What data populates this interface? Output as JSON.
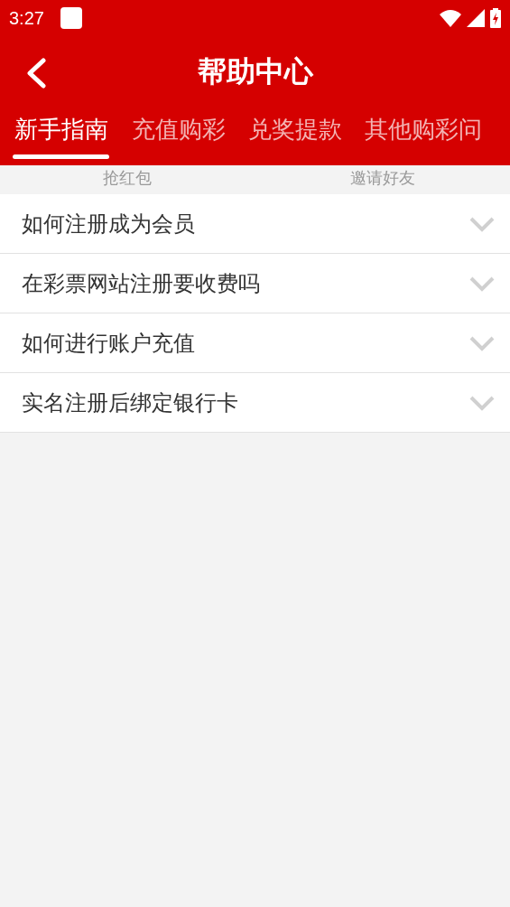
{
  "status_bar": {
    "time": "3:27"
  },
  "header": {
    "title": "帮助中心"
  },
  "tabs": [
    {
      "label": "新手指南",
      "selected": true
    },
    {
      "label": "充值购彩",
      "selected": false
    },
    {
      "label": "兑奖提款",
      "selected": false
    },
    {
      "label": "其他购彩问",
      "selected": false
    }
  ],
  "background_links": [
    "抢红包",
    "邀请好友"
  ],
  "questions": [
    {
      "title": "如何注册成为会员",
      "expanded": false
    },
    {
      "title": "在彩票网站注册要收费吗",
      "expanded": false
    },
    {
      "title": "如何进行账户充值",
      "expanded": false
    },
    {
      "title": "实名注册后绑定银行卡",
      "expanded": false
    }
  ]
}
